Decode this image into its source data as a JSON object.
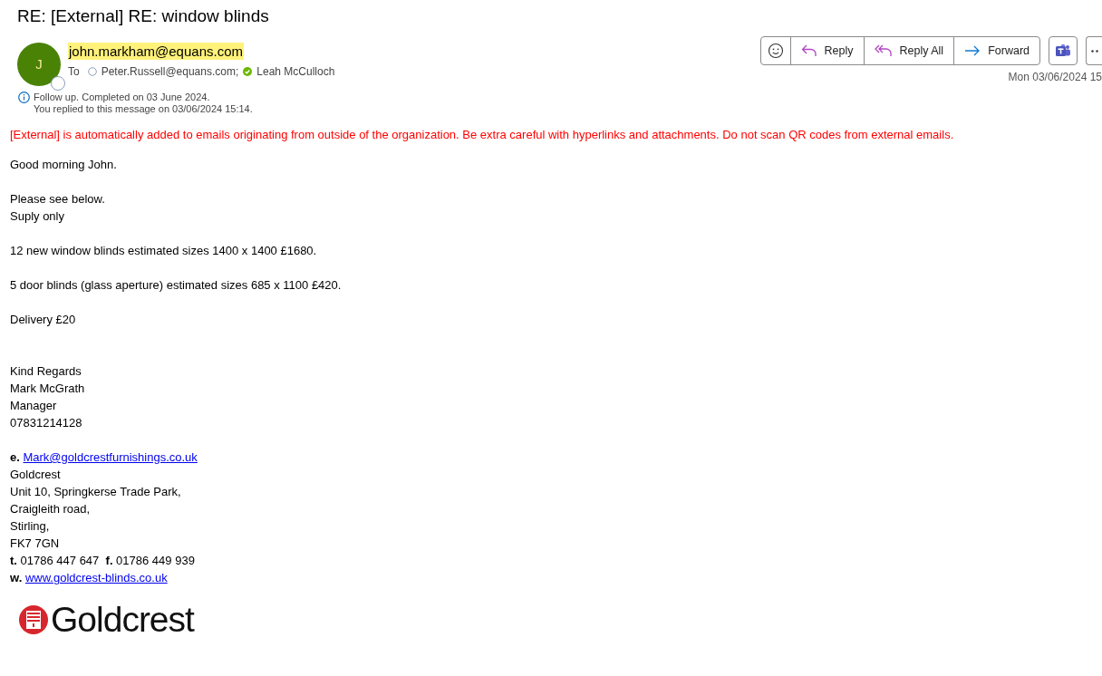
{
  "subject": "RE: [External] RE: window blinds",
  "sender": {
    "initial": "J",
    "email": "john.markham@equans.com",
    "highlighted": true
  },
  "to_label": "To",
  "recipients": [
    {
      "name": "Peter.Russell@equans.com;",
      "verified": false
    },
    {
      "name": "Leah McCulloch",
      "verified": true
    }
  ],
  "info": [
    "Follow up.  Completed on 03 June 2024.",
    "You replied to this message on 03/06/2024 15:14."
  ],
  "actions": [
    {
      "kind": "emoji"
    },
    {
      "kind": "reply",
      "label": "Reply"
    },
    {
      "kind": "reply-all",
      "label": "Reply All"
    },
    {
      "kind": "forward",
      "label": "Forward"
    }
  ],
  "date": "Mon 03/06/2024 15",
  "warning": "[External] is automatically added to emails originating from outside of the organization. Be extra careful with hyperlinks and attachments. Do not scan QR codes from external emails.",
  "body": [
    {
      "kind": "text",
      "text": "Good morning John."
    },
    {
      "kind": "blank"
    },
    {
      "kind": "text",
      "text": "Please see below."
    },
    {
      "kind": "text",
      "text": "Suply only"
    },
    {
      "kind": "blank"
    },
    {
      "kind": "text",
      "text": "12 new window blinds estimated sizes 1400 x 1400 £1680."
    },
    {
      "kind": "blank"
    },
    {
      "kind": "text",
      "text": "5 door blinds (glass aperture) estimated sizes 685 x 1100 £420."
    },
    {
      "kind": "blank"
    },
    {
      "kind": "text",
      "text": "Delivery £20"
    },
    {
      "kind": "blank"
    },
    {
      "kind": "blank"
    },
    {
      "kind": "text",
      "text": "Kind Regards"
    },
    {
      "kind": "text",
      "text": "Mark McGrath"
    },
    {
      "kind": "text",
      "text": "Manager"
    },
    {
      "kind": "text",
      "text": "07831214128"
    },
    {
      "kind": "blank"
    },
    {
      "kind": "link",
      "prefix": "e.",
      "link": "Mark@goldcrestfurnishings.co.uk"
    },
    {
      "kind": "text",
      "text": "Goldcrest"
    },
    {
      "kind": "text",
      "text": "Unit 10, Springkerse Trade Park,"
    },
    {
      "kind": "text",
      "text": "Craigleith road,"
    },
    {
      "kind": "text",
      "text": "Stirling,"
    },
    {
      "kind": "text",
      "text": "FK7 7GN"
    },
    {
      "kind": "text",
      "text": "**t.** 01786 447 647  **f.** 01786 449 939"
    },
    {
      "kind": "link",
      "prefix": "w.",
      "link": "www.goldcrest-blinds.co.uk"
    }
  ],
  "logo": {
    "text": "Goldcrest"
  }
}
